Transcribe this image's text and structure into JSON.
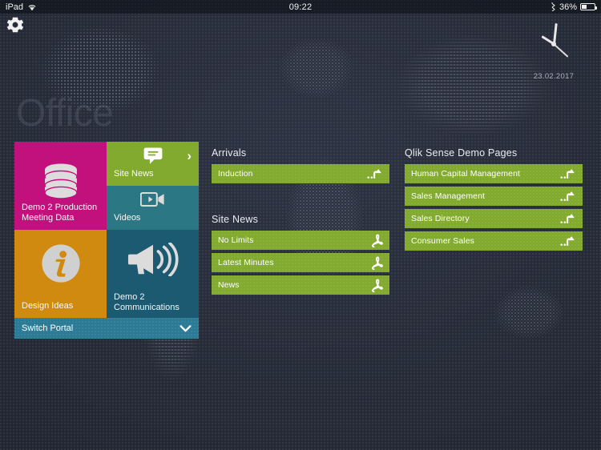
{
  "status_bar": {
    "device": "iPad",
    "wifi_icon": "wifi-icon",
    "time": "09:22",
    "bluetooth_icon": "bluetooth-icon",
    "battery_percent": "36%",
    "battery_icon": "battery-icon"
  },
  "settings_icon": "gear-icon",
  "clock": {
    "date": "23.02.2017",
    "hour_angle_deg": -58,
    "minute_angle_deg": 6,
    "second_angle_deg": 132
  },
  "watermark": "Office",
  "tiles": [
    {
      "label": "Demo 2 Production Meeting Data",
      "color": "#c2117c",
      "icon": "database-icon",
      "name": "tile-demo2-production-meeting-data"
    },
    {
      "label": "Site News",
      "color": "#82aa2e",
      "icon": "speech-bubble-icon",
      "badge_icon": "chevron-right-icon",
      "name": "tile-site-news"
    },
    {
      "label": "Videos",
      "color": "#2c7784",
      "icon": "video-camera-icon",
      "name": "tile-videos"
    },
    {
      "label": "Design Ideas",
      "color": "#d08a0f",
      "icon": "info-circle-icon",
      "name": "tile-design-ideas"
    },
    {
      "label": "Demo 2 Communications",
      "color": "#1c5a72",
      "icon": "megaphone-icon",
      "name": "tile-demo2-communications"
    }
  ],
  "switch_portal": {
    "label": "Switch Portal",
    "icon": "chevron-down-icon",
    "color": "#2b7a96"
  },
  "sections": {
    "arrivals": {
      "title": "Arrivals",
      "items": [
        {
          "label": "Induction",
          "icon": "external-link-icon"
        }
      ]
    },
    "site_news": {
      "title": "Site News",
      "items": [
        {
          "label": "No Limits",
          "icon": "pdf-icon"
        },
        {
          "label": "Latest Minutes",
          "icon": "pdf-icon"
        },
        {
          "label": "News",
          "icon": "pdf-icon"
        }
      ]
    },
    "qlik_sense": {
      "title": "Qlik Sense Demo Pages",
      "items": [
        {
          "label": "Human Capital Management",
          "icon": "external-link-icon"
        },
        {
          "label": "Sales Management",
          "icon": "external-link-icon"
        },
        {
          "label": "Sales Directory",
          "icon": "external-link-icon"
        },
        {
          "label": "Consumer Sales",
          "icon": "external-link-icon"
        }
      ]
    }
  },
  "colors": {
    "accent_green": "#82aa2e",
    "magenta": "#c2117c",
    "orange": "#d08a0f",
    "teal": "#2c7784",
    "dark_teal": "#1c5a72",
    "portal_blue": "#2b7a96",
    "background": "#262b38"
  }
}
